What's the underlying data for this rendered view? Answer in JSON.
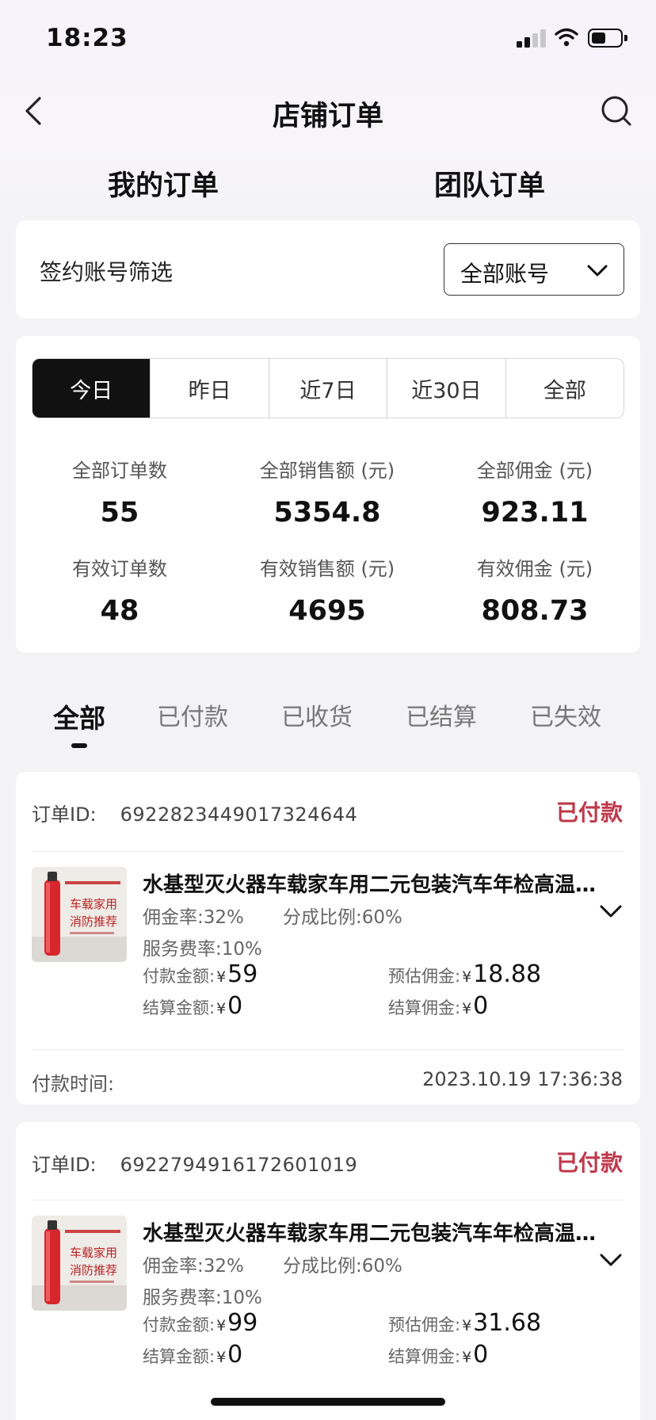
{
  "status_bar": {
    "time": "18:23"
  },
  "nav": {
    "title": "店铺订单"
  },
  "top_tabs": {
    "mine": "我的订单",
    "team": "团队订单"
  },
  "filter": {
    "label": "签约账号筛选",
    "selected": "全部账号"
  },
  "date_range": {
    "options": [
      "今日",
      "昨日",
      "近7日",
      "近30日",
      "全部"
    ],
    "active": "今日"
  },
  "stats": [
    {
      "label": "全部订单数",
      "value": "55"
    },
    {
      "label": "全部销售额 (元)",
      "value": "5354.8"
    },
    {
      "label": "全部佣金 (元)",
      "value": "923.11"
    },
    {
      "label": "有效订单数",
      "value": "48"
    },
    {
      "label": "有效销售额 (元)",
      "value": "4695"
    },
    {
      "label": "有效佣金 (元)",
      "value": "808.73"
    }
  ],
  "status_tabs": {
    "items": [
      "全部",
      "已付款",
      "已收货",
      "已结算",
      "已失效"
    ],
    "active": "全部"
  },
  "labels": {
    "order_id": "订单ID:",
    "commission_rate": "佣金率:",
    "split_ratio": "分成比例:",
    "service_fee": "服务费率:",
    "paid_amount": "付款金额:",
    "est_commission": "预估佣金:",
    "settled_amount": "结算金额:",
    "settled_commission": "结算佣金:",
    "pay_time": "付款时间:",
    "currency": "¥",
    "product_img_line1": "车载家用",
    "product_img_line2": "消防推荐"
  },
  "orders": [
    {
      "id": "6922823449017324644",
      "status": "已付款",
      "title": "水基型灭火器车载家车用二元包装汽车年检高温…",
      "commission_rate": "32%",
      "split_ratio": "60%",
      "service_fee": "10%",
      "paid_amount": "59",
      "est_commission": "18.88",
      "settled_amount": "0",
      "settled_commission": "0",
      "pay_time": "2023.10.19 17:36:38"
    },
    {
      "id": "6922794916172601019",
      "status": "已付款",
      "title": "水基型灭火器车载家车用二元包装汽车年检高温…",
      "commission_rate": "32%",
      "split_ratio": "60%",
      "service_fee": "10%",
      "paid_amount": "99",
      "est_commission": "31.68",
      "settled_amount": "0",
      "settled_commission": "0"
    }
  ],
  "colors": {
    "status_paid": "#c0384a",
    "active_segment": "#111111"
  },
  "icons": [
    "back-arrow-icon",
    "search-icon",
    "chevron-down-icon",
    "signal-icon",
    "wifi-icon",
    "battery-icon"
  ]
}
